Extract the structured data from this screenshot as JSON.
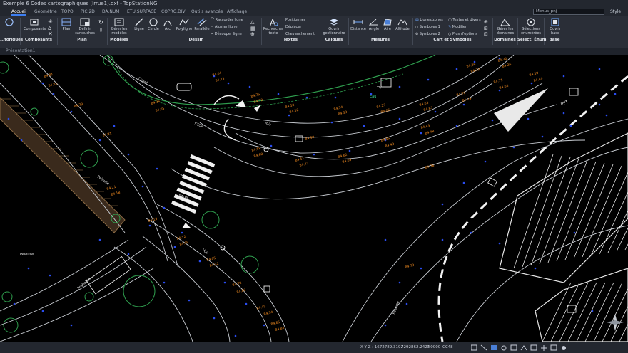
{
  "window": {
    "title": "Exemple 6 Codes cartographiques (Irrue1).dxf - TopStationNG"
  },
  "tabs": [
    "Accueil",
    "Géométrie",
    "TOPO",
    "PIC.2D",
    "DA.NUM",
    "ETU.SURFACE",
    "COPRO.DIV",
    "Outils avancés",
    "Affichage"
  ],
  "search": {
    "value": "Menus_pnj"
  },
  "style_label": "Style",
  "ribbon": {
    "groups": [
      "...toriques",
      "Composants",
      "Plan",
      "Modèles",
      "Dessin",
      "Textes",
      "Calques",
      "Mesures",
      "Cart et Symboles",
      "Domaines",
      "Sélect. Énum",
      "Base"
    ],
    "composants_btn": "Composants",
    "plan_btn": "Plan",
    "cartouches_btn": "Définir cartouches",
    "modeles_btn": "Gérer les modèles",
    "ligne": "Ligne",
    "cercle": "Cercle",
    "arc": "Arc",
    "polyligne": "Polyligne",
    "parallele": "Parallèle",
    "raccorder": "Raccorder ligne",
    "ajuster": "Ajuster ligne",
    "decouper": "Découper ligne",
    "rechercher": "Rechercher texte",
    "positionner": "Positionner",
    "deplacer": "Déplacer",
    "chevauchement": "Chevauchement",
    "ouvrir_gest": "Ouvrir gestionnaire",
    "distance": "Distance",
    "angle": "Angle",
    "aire": "Aire",
    "altitude": "Altitude",
    "lignes_zones": "Lignes/zones",
    "symboles1": "Symboles 1",
    "symboles2": "Symboles 2",
    "textes_divers": "Textes et divers",
    "modifier": "Modifier",
    "plus_options": "Plus d'options",
    "gerer_domaines": "Gérer les domaines",
    "selections": "Sélections énumérées",
    "ouvrir_base": "Ouvrir base"
  },
  "doc_tab": "Présentation1",
  "status": {
    "coords": "X Y Z : 1672789.3192",
    "y": "7292862.2424",
    "z": "0.0000",
    "proj": "CC48"
  },
  "map_labels": {
    "voir1": "Voir",
    "voir2": "Voir",
    "stop1": "STOP",
    "stop2": "STOP",
    "cimetr": "Cimet",
    "pelouse1": "Pelouse",
    "pelouse2": "Pelouse",
    "pelouse3": "Pelouse",
    "potalite": "Posbalité",
    "pelouse4": "Pelouse",
    "tv": "TV",
    "eau": "Eau",
    "pft": "PFT"
  },
  "elevations": [
    "84.81",
    "84.82",
    "84.73",
    "84.91",
    "84.96",
    "84.65",
    "84.64",
    "84.73",
    "84.75",
    "84.72",
    "84.53",
    "84.52",
    "84.54",
    "84.39",
    "84.27",
    "84.06",
    "84.63",
    "84.67",
    "84.70",
    "84.74",
    "84.71",
    "84.68",
    "84.59",
    "84.44",
    "84.58",
    "84.60",
    "84.51",
    "84.47",
    "84.62",
    "84.69",
    "84.55",
    "84.49",
    "84.43",
    "84.48",
    "84.36",
    "84.33",
    "84.30",
    "84.26",
    "84.21",
    "84.18",
    "84.15",
    "84.12",
    "84.09",
    "84.05",
    "84.02",
    "84.78",
    "84.80",
    "84.45",
    "84.34",
    "84.85",
    "84.88",
    "84.90",
    "84.76",
    "84.79"
  ]
}
